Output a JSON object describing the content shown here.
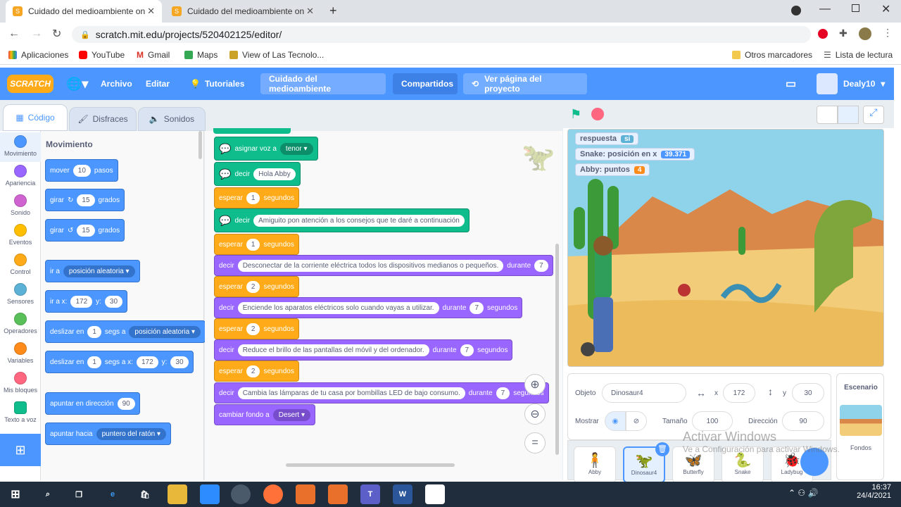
{
  "browser": {
    "tabs": [
      {
        "title": "Cuidado del medioambiente on"
      },
      {
        "title": "Cuidado del medioambiente on"
      }
    ],
    "url": "scratch.mit.edu/projects/520402125/editor/",
    "bookmarks": [
      "Aplicaciones",
      "YouTube",
      "Gmail",
      "Maps",
      "View of Las Tecnolo..."
    ],
    "other_bookmarks": "Otros marcadores",
    "reading_list": "Lista de lectura"
  },
  "scratch_menu": {
    "logo": "SCRATCH",
    "file": "Archivo",
    "edit": "Editar",
    "tutorials": "Tutoriales",
    "project_title": "Cuidado del medioambiente",
    "share": "Compartidos",
    "see_project": "Ver página del proyecto",
    "user": "Dealy10"
  },
  "editor_tabs": {
    "code": "Código",
    "costumes": "Disfraces",
    "sounds": "Sonidos"
  },
  "categories": [
    {
      "label": "Movimiento",
      "color": "#4c97ff"
    },
    {
      "label": "Apariencia",
      "color": "#9966ff"
    },
    {
      "label": "Sonido",
      "color": "#cf63cf"
    },
    {
      "label": "Eventos",
      "color": "#ffbf00"
    },
    {
      "label": "Control",
      "color": "#ffab19"
    },
    {
      "label": "Sensores",
      "color": "#5cb1d6"
    },
    {
      "label": "Operadores",
      "color": "#59c059"
    },
    {
      "label": "Variables",
      "color": "#ff8c1a"
    },
    {
      "label": "Mis bloques",
      "color": "#ff6680"
    },
    {
      "label": "Texto a voz",
      "color": "#0fbd8c"
    }
  ],
  "palette": {
    "heading": "Movimiento",
    "move": {
      "a": "mover",
      "v": "10",
      "b": "pasos"
    },
    "turn_right": {
      "a": "girar",
      "v": "15",
      "b": "grados"
    },
    "turn_left": {
      "a": "girar",
      "v": "15",
      "b": "grados"
    },
    "goto": {
      "a": "ir a",
      "dd": "posición aleatoria"
    },
    "goto_xy": {
      "a": "ir a x:",
      "x": "172",
      "ylab": "y:",
      "y": "30"
    },
    "glide": {
      "a": "deslizar en",
      "v": "1",
      "b": "segs a",
      "dd": "posición aleatoria"
    },
    "glide_xy": {
      "a": "deslizar en",
      "v": "1",
      "b": "segs a x:",
      "x": "172",
      "ylab": "y:",
      "y": "30"
    },
    "point_dir": {
      "a": "apuntar en dirección",
      "v": "90"
    },
    "point_to": {
      "a": "apuntar hacia",
      "dd": "puntero del ratón"
    }
  },
  "script": [
    {
      "kind": "tts",
      "a": "asignar voz a",
      "dd": "tenor"
    },
    {
      "kind": "tts",
      "a": "decir",
      "v": "Hola Abby"
    },
    {
      "kind": "wait",
      "a": "esperar",
      "v": "1",
      "b": "segundos"
    },
    {
      "kind": "tts",
      "a": "decir",
      "v": "Amiguito pon atención a los consejos que te daré a continuación"
    },
    {
      "kind": "wait",
      "a": "esperar",
      "v": "1",
      "b": "segundos"
    },
    {
      "kind": "say",
      "a": "decir",
      "v": "Desconectar de la corriente eléctrica todos los dispositivos medianos o pequeños.",
      "c": "durante",
      "n": "7"
    },
    {
      "kind": "wait",
      "a": "esperar",
      "v": "2",
      "b": "segundos"
    },
    {
      "kind": "say",
      "a": "decir",
      "v": "Enciende los aparatos eléctricos solo cuando vayas a utilizar.",
      "c": "durante",
      "n": "7",
      "d": "segundos"
    },
    {
      "kind": "wait",
      "a": "esperar",
      "v": "2",
      "b": "segundos"
    },
    {
      "kind": "say",
      "a": "decir",
      "v": "Reduce el brillo de las pantallas del móvil y del ordenador.",
      "c": "durante",
      "n": "7",
      "d": "segundos"
    },
    {
      "kind": "wait",
      "a": "esperar",
      "v": "2",
      "b": "segundos"
    },
    {
      "kind": "say",
      "a": "decir",
      "v": "Cambia las lámparas de tu casa por bombillas LED de bajo consumo.",
      "c": "durante",
      "n": "7",
      "d": "segundos"
    },
    {
      "kind": "looks",
      "a": "cambiar fondo a",
      "dd": "Desert"
    }
  ],
  "monitors": [
    {
      "label": "respuesta",
      "value": "si",
      "color": "#5cb1d6"
    },
    {
      "label": "Snake: posición en x",
      "value": "39.371",
      "color": "#4c97ff"
    },
    {
      "label": "Abby: puntos",
      "value": "4",
      "color": "#ff8c1a"
    }
  ],
  "sprite_info": {
    "object_label": "Objeto",
    "object_name": "Dinosaur4",
    "x_label": "x",
    "x": "172",
    "y_label": "y",
    "y": "30",
    "show_label": "Mostrar",
    "size_label": "Tamaño",
    "size": "100",
    "direction_label": "Dirección",
    "direction": "90"
  },
  "sprites": [
    "Abby",
    "Dinosaur4",
    "Butterfly",
    "Snake",
    "Ladybug"
  ],
  "backdrop_panel": {
    "title": "Escenario",
    "label": "Fondos"
  },
  "watermark": {
    "line1": "Activar Windows",
    "line2": "Ve a Configuración para activar Windows."
  },
  "taskbar": {
    "time": "16:37",
    "date": "24/4/2021"
  }
}
